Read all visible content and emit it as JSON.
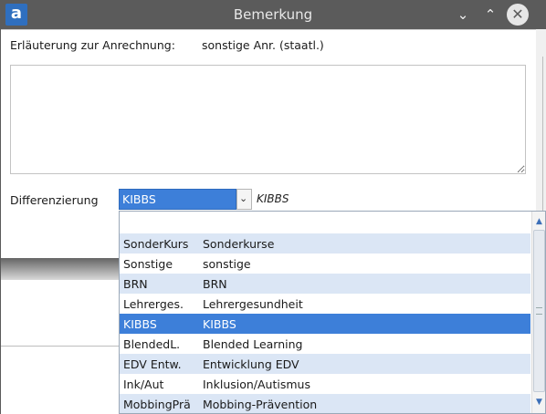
{
  "window": {
    "title": "Bemerkung",
    "app_icon_letter": "a"
  },
  "form": {
    "erlaeuterung_label": "Erläuterung zur Anrechnung:",
    "erlaeuterung_value": "sonstige Anr. (staatl.)",
    "bemerkung_text": "",
    "differenzierung_label": "Differenzierung",
    "differenzierung_selected": "KIBBS",
    "differenzierung_description": "KIBBS"
  },
  "dropdown": {
    "items": [
      {
        "code": "",
        "name": "",
        "selected": false
      },
      {
        "code": "SonderKurs",
        "name": "Sonderkurse",
        "selected": false
      },
      {
        "code": "Sonstige",
        "name": "sonstige",
        "selected": false
      },
      {
        "code": "BRN",
        "name": "BRN",
        "selected": false
      },
      {
        "code": "Lehrerges.",
        "name": "Lehrergesundheit",
        "selected": false
      },
      {
        "code": "KIBBS",
        "name": "KIBBS",
        "selected": true
      },
      {
        "code": "BlendedL.",
        "name": "Blended Learning",
        "selected": false
      },
      {
        "code": "EDV Entw.",
        "name": "Entwicklung EDV",
        "selected": false
      },
      {
        "code": "Ink/Aut",
        "name": "Inklusion/Autismus",
        "selected": false
      },
      {
        "code": "MobbingPrä",
        "name": "Mobbing-Prävention",
        "selected": false
      }
    ]
  },
  "icons": {
    "minimize": "chevron-down-icon",
    "maximize": "chevron-up-icon",
    "close": "close-icon",
    "combo_arrow": "chevron-down-icon",
    "scroll_up": "triangle-up-icon",
    "scroll_down": "triangle-down-icon"
  },
  "colors": {
    "titlebar": "#5b5b5b",
    "selection": "#3d7fd9",
    "alt_row": "#dbe6f5",
    "app_icon": "#2f6fbf"
  }
}
